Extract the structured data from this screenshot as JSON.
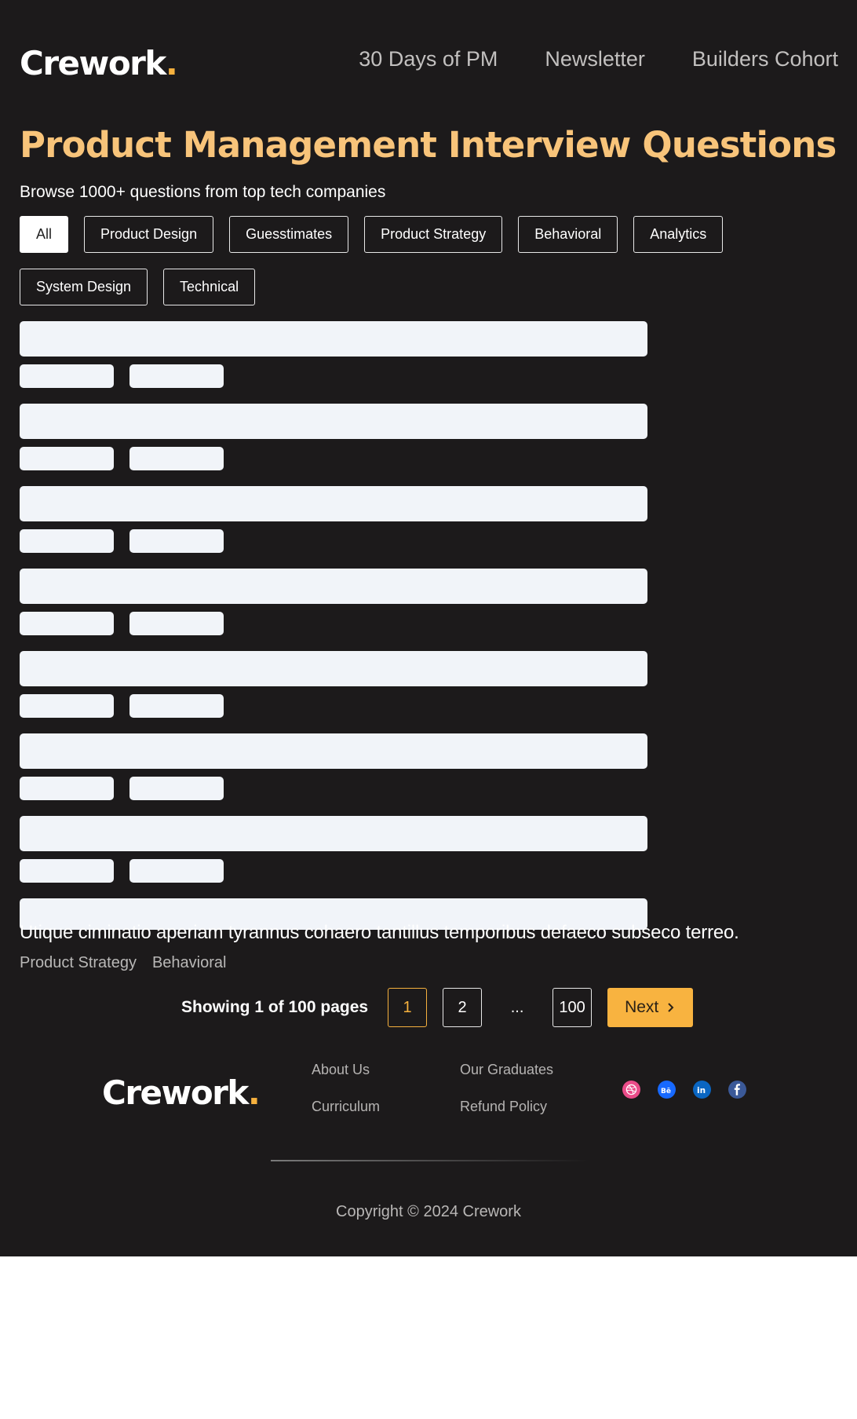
{
  "brand": {
    "name": "Crework",
    "dot": "."
  },
  "nav": [
    {
      "label": "30 Days of PM"
    },
    {
      "label": "Newsletter"
    },
    {
      "label": "Builders Cohort"
    }
  ],
  "page_title": "Product Management Interview Questions",
  "subtitle": "Browse 1000+ questions from top tech companies",
  "filters": [
    {
      "label": "All",
      "active": true
    },
    {
      "label": "Product Design",
      "active": false
    },
    {
      "label": "Guesstimates",
      "active": false
    },
    {
      "label": "Product Strategy",
      "active": false
    },
    {
      "label": "Behavioral",
      "active": false
    },
    {
      "label": "Analytics",
      "active": false
    },
    {
      "label": "System Design",
      "active": false
    },
    {
      "label": "Technical",
      "active": false
    }
  ],
  "question": {
    "text": "Utique ciminatio aperiam tyrannus cohaero tantillus temporibus defaeco subseco terreo.",
    "tags": [
      "Product Strategy",
      "Behavioral"
    ]
  },
  "pagination": {
    "info": "Showing 1 of 100 pages",
    "pages": [
      "1",
      "2"
    ],
    "ellipsis": "...",
    "last": "100",
    "current": "1",
    "next_label": "Next"
  },
  "footer": {
    "links": [
      {
        "label": "About Us"
      },
      {
        "label": "Our Graduates"
      },
      {
        "label": "Curriculum"
      },
      {
        "label": "Refund Policy"
      }
    ],
    "socials": [
      {
        "icon": "dribbble-icon",
        "color": "#ea4c89"
      },
      {
        "icon": "behance-icon",
        "color": "#1769ff"
      },
      {
        "icon": "linkedin-icon",
        "color": "#0a66c2"
      },
      {
        "icon": "facebook-icon",
        "color": "#3b5998"
      }
    ],
    "copyright": "Copyright © 2024 Crework"
  },
  "colors": {
    "background": "#1c1a1b",
    "accent": "#f6b13e",
    "title": "#f8c47a",
    "skeleton": "#f1f4f9"
  }
}
